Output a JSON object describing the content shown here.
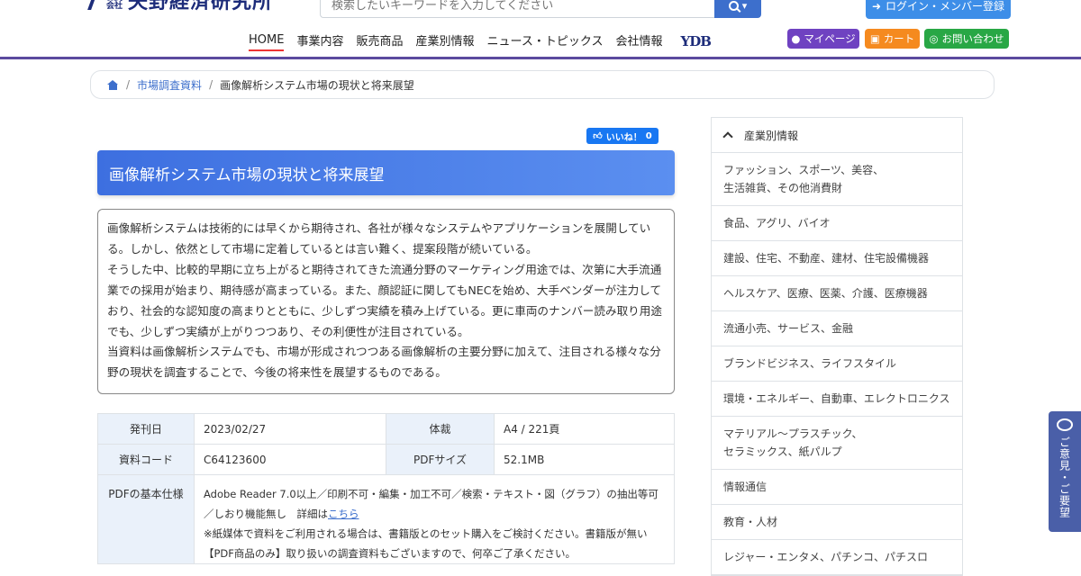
{
  "header": {
    "logo_small": "株式会社",
    "logo_text": "矢野経済研究所",
    "search_placeholder": "検索したいキーワードを入力してください",
    "login_label": "ログイン・メンバー登録",
    "nav": [
      "HOME",
      "事業内容",
      "販売商品",
      "産業別情報",
      "ニュース・トピックス",
      "会社情報"
    ],
    "ydb": "YDB",
    "mypage_label": "マイページ",
    "cart_label": "カート",
    "contact_label": "お問い合わせ"
  },
  "breadcrumb": {
    "link": "市場調査資料",
    "current": "画像解析システム市場の現状と将来展望"
  },
  "like": {
    "label": "いいね！",
    "count": "0"
  },
  "report": {
    "title": "画像解析システム市場の現状と将来展望",
    "description": [
      "画像解析システムは技術的には早くから期待され、各社が様々なシステムやアプリケーションを展開している。しかし、依然として市場に定着しているとは言い難く、提案段階が続いている。",
      "そうした中、比較的早期に立ち上がると期待されてきた流通分野のマーケティング用途では、次第に大手流通業での採用が始まり、期待感が高まっている。また、顔認証に関してもNECを始め、大手ベンダーが注力しており、社会的な認知度の高まりとともに、少しずつ実績を積み上げている。更に車両のナンバー読み取り用途でも、少しずつ実績が上がりつつあり、その利便性が注目されている。",
      "当資料は画像解析システムでも、市場が形成されつつある画像解析の主要分野に加えて、注目される様々な分野の現状を調査することで、今後の将来性を展望するものである。"
    ]
  },
  "spec": {
    "issue_label": "発刊日",
    "issue_value": "2023/02/27",
    "format_label": "体裁",
    "format_value": "A4 / 221頁",
    "code_label": "資料コード",
    "code_value": "C64123600",
    "size_label": "PDFサイズ",
    "size_value": "52.1MB",
    "pdf_label": "PDFの基本仕様",
    "pdf_line1": "Adobe Reader 7.0以上／印刷不可・編集・加工不可／検索・テキスト・図（グラフ）の抽出等可／しおり機能無し　詳細は",
    "pdf_link": "こちら",
    "pdf_line2": "※紙媒体で資料をご利用される場合は、書籍版とのセット購入をご検討ください。書籍版が無い【PDF商品のみ】取り扱いの調査資料もございますので、何卒ご了承ください。"
  },
  "sidebar": {
    "heading": "産業別情報",
    "items": [
      "ファッション、スポーツ、美容、\n生活雑貨、その他消費財",
      "食品、アグリ、バイオ",
      "建設、住宅、不動産、建材、住宅設備機器",
      "ヘルスケア、医療、医薬、介護、医療機器",
      "流通小売、サービス、金融",
      "ブランドビジネス、ライフスタイル",
      "環境・エネルギー、自動車、エレクトロニクス",
      "マテリアル～プラスチック、\nセラミックス、紙パルプ",
      "情報通信",
      "教育・人材",
      "レジャー・エンタメ、パチンコ、パチスロ"
    ]
  },
  "feedback": {
    "label": "ご意見・ご要望"
  }
}
